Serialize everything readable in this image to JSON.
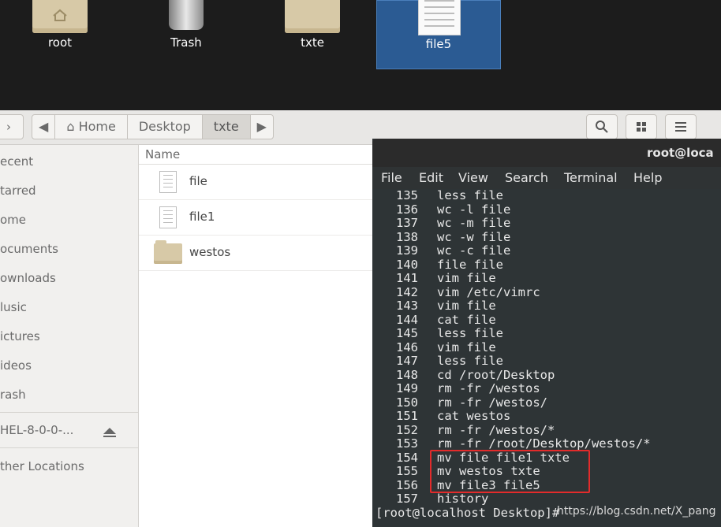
{
  "desktop": {
    "icons": [
      {
        "label": "root",
        "type": "home-folder"
      },
      {
        "label": "Trash",
        "type": "trash"
      },
      {
        "label": "txte",
        "type": "folder"
      },
      {
        "label": "file5",
        "type": "document",
        "selected": true
      }
    ]
  },
  "file_manager": {
    "breadcrumb": {
      "home": "Home",
      "desktop": "Desktop",
      "current": "txte"
    },
    "sidebar": {
      "items": [
        "ecent",
        "tarred",
        "ome",
        "ocuments",
        "ownloads",
        "lusic",
        "ictures",
        "ideos",
        "rash"
      ],
      "device": "HEL-8-0-0-...",
      "other": "ther Locations"
    },
    "list": {
      "column_name": "Name",
      "rows": [
        {
          "name": "file",
          "type": "file"
        },
        {
          "name": "file1",
          "type": "file"
        },
        {
          "name": "westos",
          "type": "folder"
        }
      ]
    }
  },
  "terminal": {
    "title": "root@loca",
    "menu": [
      "File",
      "Edit",
      "View",
      "Search",
      "Terminal",
      "Help"
    ],
    "history": [
      {
        "n": "135",
        "cmd": "less file"
      },
      {
        "n": "136",
        "cmd": "wc -l file"
      },
      {
        "n": "137",
        "cmd": "wc -m file"
      },
      {
        "n": "138",
        "cmd": "wc -w file"
      },
      {
        "n": "139",
        "cmd": "wc -c file"
      },
      {
        "n": "140",
        "cmd": "file file"
      },
      {
        "n": "141",
        "cmd": "vim file"
      },
      {
        "n": "142",
        "cmd": "vim /etc/vimrc"
      },
      {
        "n": "143",
        "cmd": "vim file"
      },
      {
        "n": "144",
        "cmd": "cat file"
      },
      {
        "n": "145",
        "cmd": "less file"
      },
      {
        "n": "146",
        "cmd": "vim file"
      },
      {
        "n": "147",
        "cmd": "less file"
      },
      {
        "n": "148",
        "cmd": "cd /root/Desktop"
      },
      {
        "n": "149",
        "cmd": "rm -fr /westos"
      },
      {
        "n": "150",
        "cmd": "rm -fr /westos/"
      },
      {
        "n": "151",
        "cmd": "cat westos"
      },
      {
        "n": "152",
        "cmd": "rm -fr /westos/*"
      },
      {
        "n": "153",
        "cmd": "rm -fr /root/Desktop/westos/*"
      },
      {
        "n": "154",
        "cmd": "mv file file1 txte"
      },
      {
        "n": "155",
        "cmd": "mv westos txte"
      },
      {
        "n": "156",
        "cmd": "mv file3 file5"
      },
      {
        "n": "157",
        "cmd": "history"
      }
    ],
    "prompt": "[root@localhost Desktop]#",
    "highlight_color": "#e32b2b"
  },
  "watermark": "https://blog.csdn.net/X_pang"
}
